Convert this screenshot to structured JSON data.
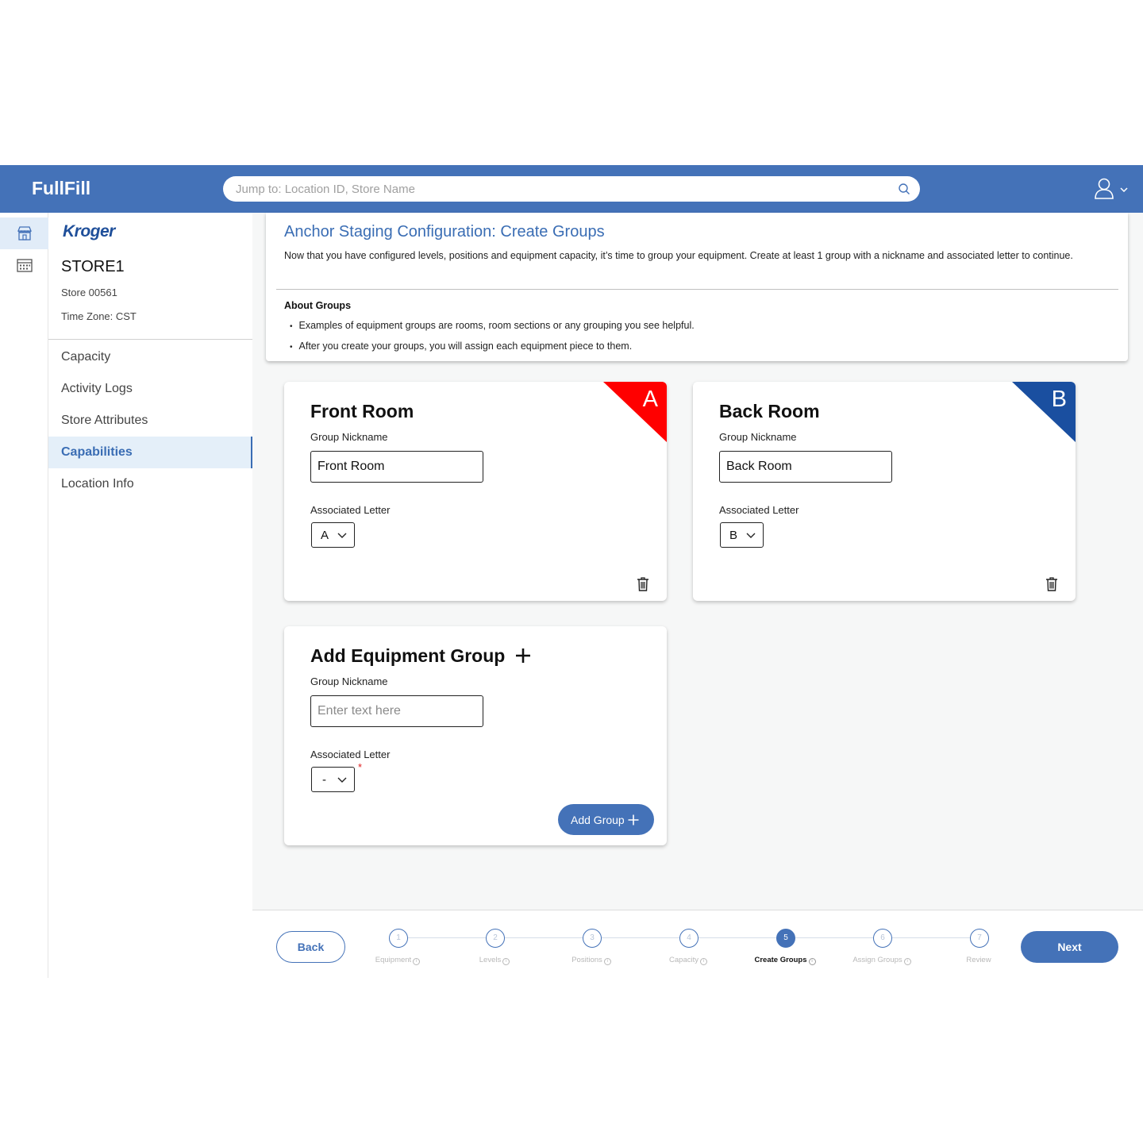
{
  "header": {
    "app_title": "FullFill",
    "search_placeholder": "Jump to: Location ID, Store Name",
    "brand_color": "#4472b8"
  },
  "icon_rail": {
    "items": [
      {
        "icon": "store-icon",
        "active": true
      },
      {
        "icon": "calendar-icon",
        "active": false
      }
    ]
  },
  "sidebar": {
    "logo_text": "Kroger",
    "store_name": "STORE1",
    "store_id": "Store 00561",
    "time_zone": "Time Zone: CST",
    "nav": [
      {
        "label": "Capacity",
        "active": false
      },
      {
        "label": "Activity Logs",
        "active": false
      },
      {
        "label": "Store Attributes",
        "active": false
      },
      {
        "label": "Capabilities",
        "active": true
      },
      {
        "label": "Location Info",
        "active": false
      }
    ]
  },
  "info": {
    "title": "Anchor Staging Configuration: Create Groups",
    "description": "Now that you have configured levels, positions and equipment capacity, it’s time to group your equipment. Create at least 1 group with a nickname and associated letter to continue.",
    "about_heading": "About Groups",
    "bullets": [
      "Examples of equipment groups are rooms, room sections or any grouping you see helpful.",
      "After you create your groups, you will assign each equipment piece to them."
    ]
  },
  "groups": [
    {
      "title": "Front Room",
      "nickname_label": "Group Nickname",
      "nickname_value": "Front Room",
      "letter_label": "Associated Letter",
      "letter_value": "A",
      "corner_letter": "A",
      "corner_color": "#ff0000"
    },
    {
      "title": "Back Room",
      "nickname_label": "Group Nickname",
      "nickname_value": "Back Room",
      "letter_label": "Associated Letter",
      "letter_value": "B",
      "corner_letter": "B",
      "corner_color": "#1a4fa0"
    }
  ],
  "add_group": {
    "title": "Add Equipment Group",
    "nickname_label": "Group Nickname",
    "nickname_placeholder": "Enter text here",
    "letter_label": "Associated Letter",
    "letter_value": "-",
    "required_mark": "*",
    "button_label": "Add Group"
  },
  "footer": {
    "back_label": "Back",
    "next_label": "Next",
    "current_step": 5,
    "steps": [
      {
        "number": "1",
        "label": "Equipment",
        "info": true
      },
      {
        "number": "2",
        "label": "Levels",
        "info": true
      },
      {
        "number": "3",
        "label": "Positions",
        "info": true
      },
      {
        "number": "4",
        "label": "Capacity",
        "info": true
      },
      {
        "number": "5",
        "label": "Create Groups",
        "info": true
      },
      {
        "number": "6",
        "label": "Assign Groups",
        "info": true
      },
      {
        "number": "7",
        "label": "Review",
        "info": false
      }
    ]
  }
}
